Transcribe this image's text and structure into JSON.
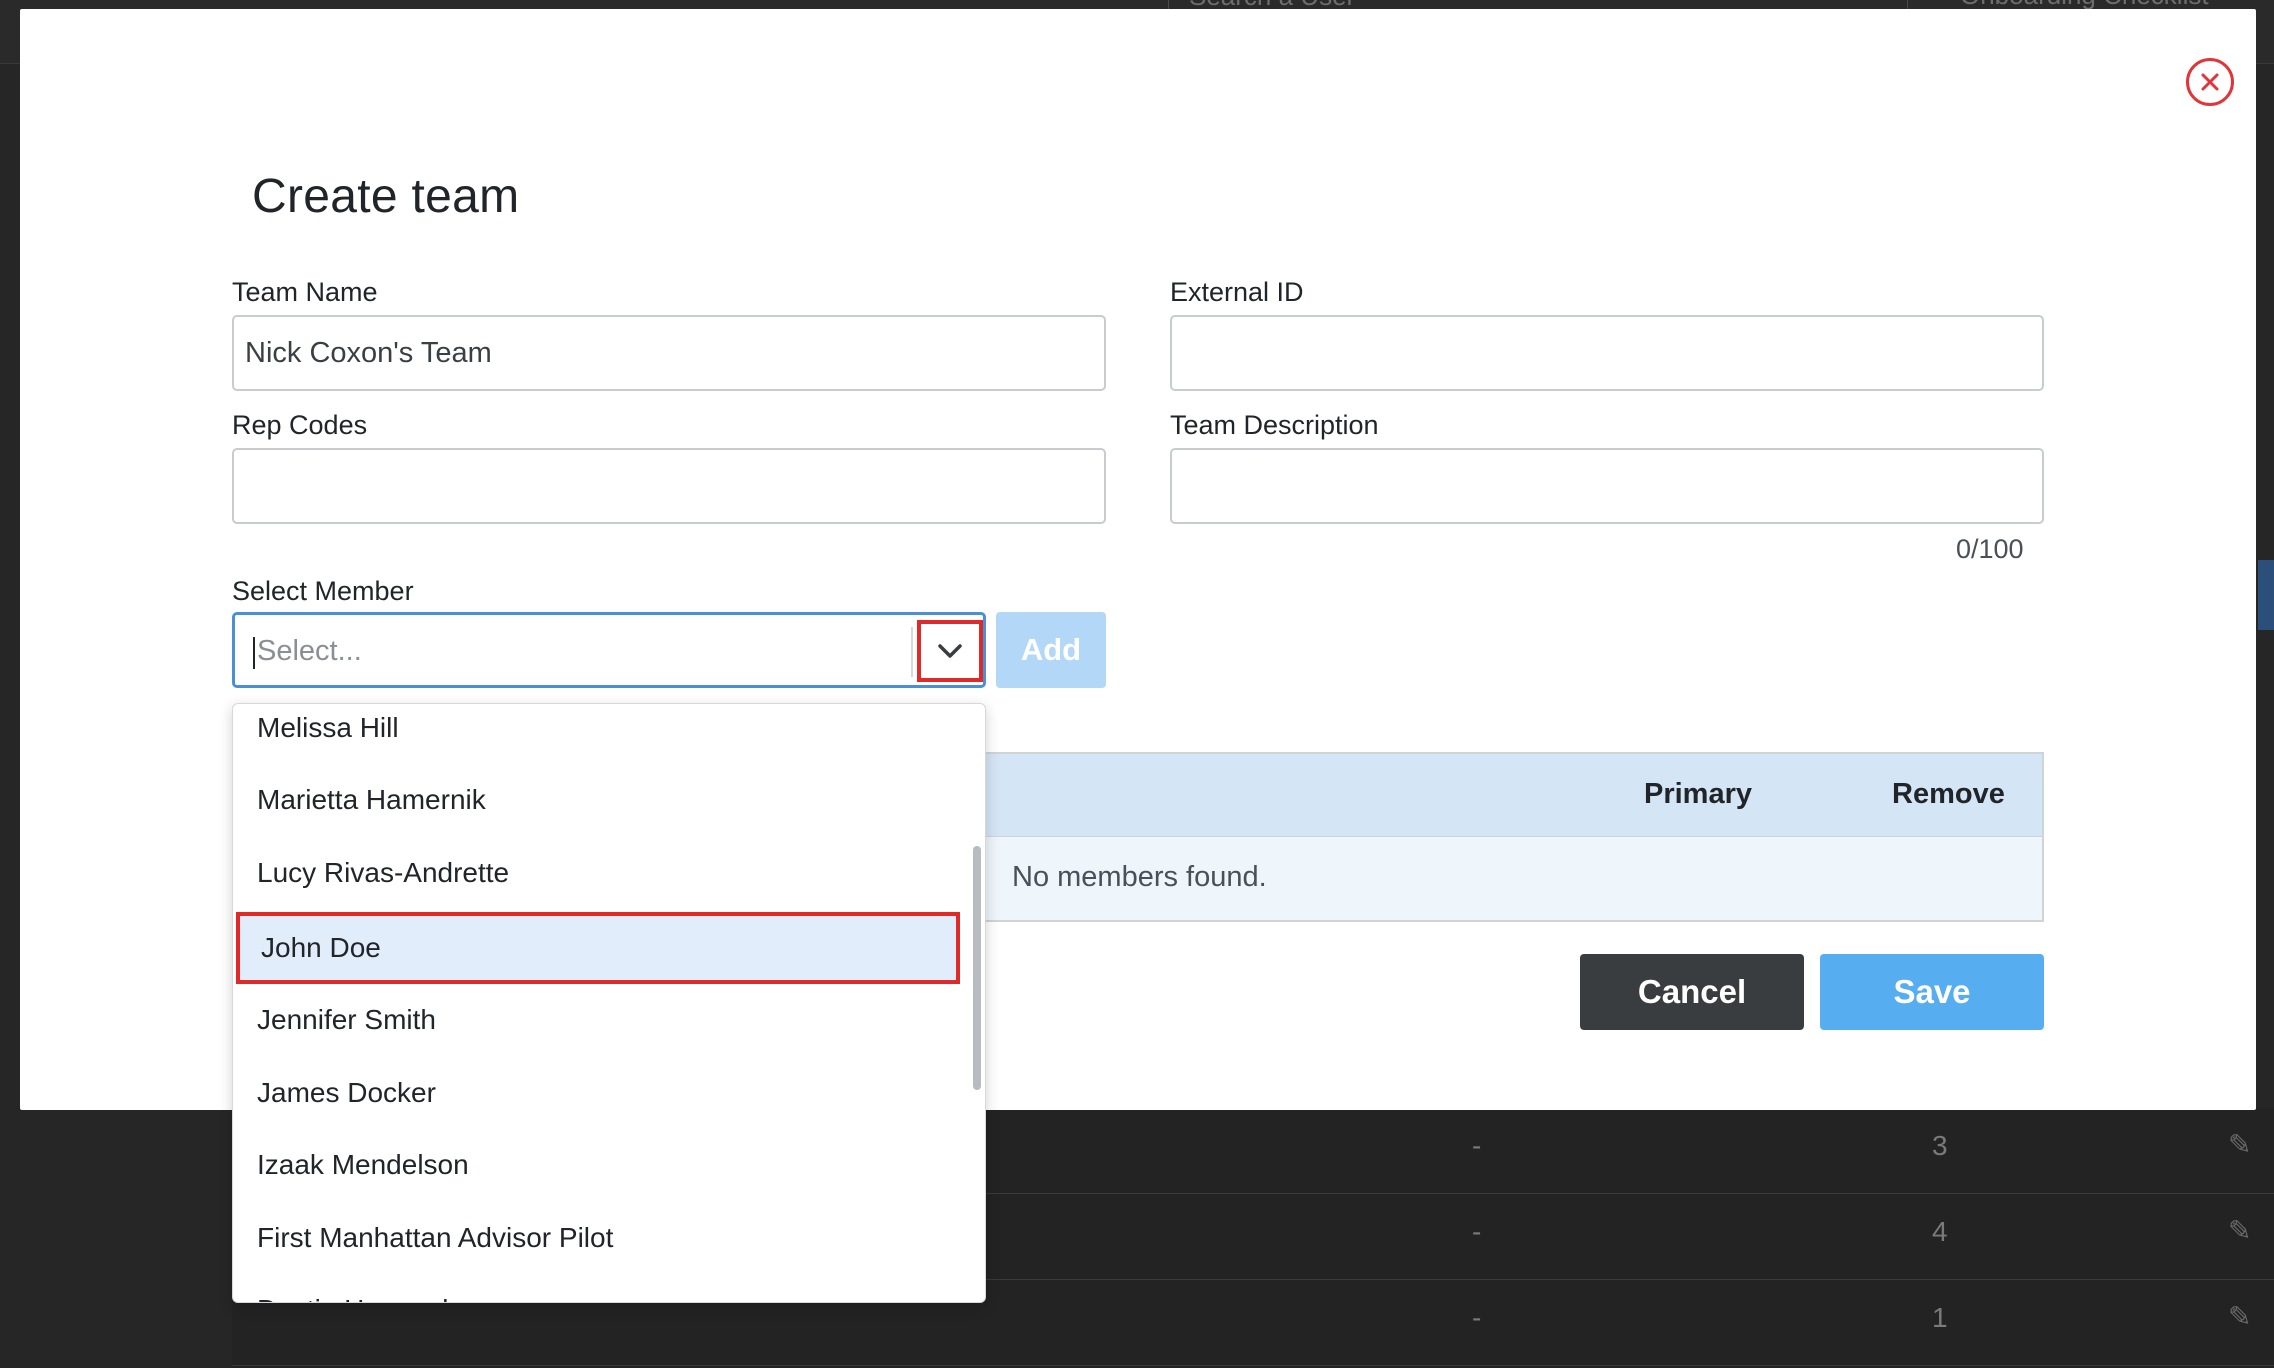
{
  "background": {
    "search_placeholder": "Search a User",
    "checklist_label": "Onboarding Checklist",
    "rows": [
      {
        "dash": "-",
        "count": "3"
      },
      {
        "dash": "-",
        "count": "4"
      },
      {
        "dash": "-",
        "count": "1"
      }
    ]
  },
  "modal": {
    "title": "Create team",
    "fields": {
      "team_name": {
        "label": "Team Name",
        "value": "Nick Coxon's Team"
      },
      "external_id": {
        "label": "External ID",
        "value": ""
      },
      "rep_codes": {
        "label": "Rep Codes",
        "value": ""
      },
      "team_description": {
        "label": "Team Description",
        "value": "",
        "counter": "0/100"
      }
    },
    "select_member": {
      "label": "Select Member",
      "placeholder": "Select...",
      "add_label": "Add"
    },
    "dropdown_options": [
      "Melissa Hill",
      "Marietta Hamernik",
      "Lucy Rivas-Andrette",
      "John Doe",
      "Jennifer Smith",
      "James Docker",
      "Izaak Mendelson",
      "First Manhattan Advisor Pilot",
      "Dustin Hassard"
    ],
    "highlighted_option": "John Doe",
    "members_table": {
      "columns": [
        "Primary",
        "Remove"
      ],
      "empty_text": "No members found."
    },
    "buttons": {
      "cancel": "Cancel",
      "save": "Save"
    },
    "colors": {
      "accent": "#56adf0",
      "highlight_outline": "#e02a2a",
      "close_icon": "#e0353a"
    }
  }
}
